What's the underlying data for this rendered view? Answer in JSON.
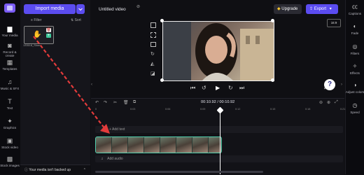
{
  "colors": {
    "accent": "#5b4cf0",
    "selection": "#4fcfae",
    "arrow": "#e23b3b"
  },
  "nav": [
    {
      "label": "Your media",
      "icon": "folder-icon"
    },
    {
      "label": "Record & create",
      "icon": "camera-icon"
    },
    {
      "label": "Templates",
      "icon": "templates-icon"
    },
    {
      "label": "Music & SFX",
      "icon": "music-icon"
    },
    {
      "label": "Text",
      "icon": "text-icon"
    },
    {
      "label": "Graphics",
      "icon": "graphics-icon"
    },
    {
      "label": "Stock video",
      "icon": "stock-video-icon"
    },
    {
      "label": "Stock images",
      "icon": "stock-images-icon"
    }
  ],
  "media_panel": {
    "import_label": "Import media",
    "filter_label": "Filter",
    "sort_label": "Sort",
    "clip_name": "133118_Slow...",
    "backup_text": "Your media isn't backed up"
  },
  "header": {
    "project_title": "Untitled video",
    "upgrade_label": "Upgrade",
    "export_label": "Export"
  },
  "preview": {
    "aspect_ratio": "16:9",
    "help": "?"
  },
  "right_panel": [
    {
      "label": "Captions",
      "icon": "captions-icon"
    },
    {
      "label": "Fade",
      "icon": "fade-icon"
    },
    {
      "label": "Filters",
      "icon": "filters-icon"
    },
    {
      "label": "Effects",
      "icon": "effects-icon"
    },
    {
      "label": "Adjust colors",
      "icon": "adjust-colors-icon"
    },
    {
      "label": "Speed",
      "icon": "speed-icon"
    }
  ],
  "timeline": {
    "timecode": "00:10.92 / 00:10.92",
    "ticks": [
      "0",
      "0:03",
      "0:06",
      "0:09",
      "0:12",
      "0:15",
      "0:18",
      "0:21"
    ],
    "add_text": "+ Add text",
    "add_audio": "Add audio"
  }
}
